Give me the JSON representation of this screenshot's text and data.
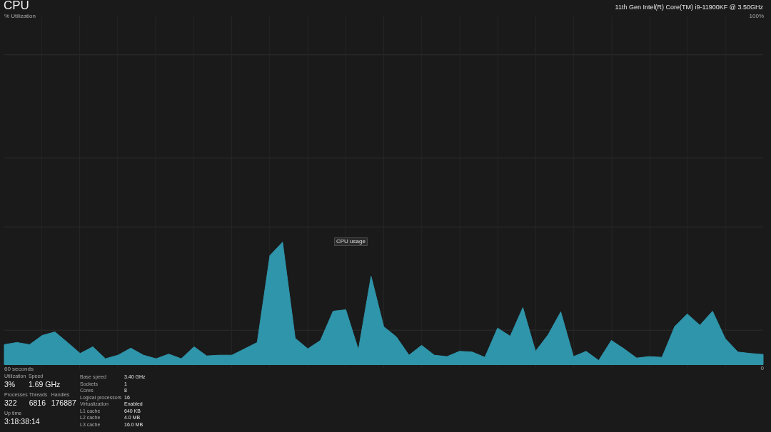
{
  "header": {
    "title": "CPU",
    "processor": "11th Gen Intel(R) Core(TM) i9-11900KF @ 3.50GHz"
  },
  "graph": {
    "chart_data": {
      "type": "area",
      "ylabel": "% Utilization",
      "xlabel": "60 seconds",
      "ylim": [
        0,
        100
      ],
      "yticks": [
        {
          "value": 100,
          "label": "100%"
        },
        {
          "value": 0,
          "label": "0"
        }
      ],
      "grid": true,
      "series": [
        {
          "color": "#2f95ab",
          "values": [
            6.8,
            7.4,
            6.8,
            9.4,
            10.4,
            7.4,
            4.3,
            6.2,
            2.8,
            3.8,
            5.8,
            3.8,
            2.8,
            4.1,
            2.8,
            6.2,
            3.6,
            3.8,
            3.8,
            5.6,
            7.4,
            32.1,
            35.9,
            8.6,
            5.6,
            8.0,
            16.3,
            16.7,
            5.3,
            26.2,
            11.9,
            9.0,
            3.8,
            6.6,
            3.8,
            3.4,
            4.9,
            4.7,
            3.2,
            11.5,
            9.2,
            17.3,
            4.9,
            9.6,
            16.1,
            3.4,
            4.9,
            2.3,
            8.0,
            5.6,
            3.0,
            3.4,
            3.2,
            11.9,
            15.5,
            12.3,
            16.3,
            8.5,
            4.7,
            4.3,
            4.0
          ]
        }
      ]
    },
    "tooltip": "CPU usage"
  },
  "stat_rows": [
    {
      "items": [
        {
          "label": "Utilization",
          "value": "3%"
        },
        {
          "label": "Speed",
          "value": "1.69 GHz"
        }
      ]
    },
    {
      "items": [
        {
          "label": "Processes",
          "value": "322"
        },
        {
          "label": "Threads",
          "value": "6816"
        },
        {
          "label": "Handles",
          "value": "176887"
        }
      ]
    },
    {
      "items": [
        {
          "label": "Up time",
          "value": "3:18:38:14"
        }
      ]
    }
  ],
  "details": [
    {
      "label": "Base speed",
      "value": "3.40 GHz"
    },
    {
      "label": "Sockets",
      "value": "1"
    },
    {
      "label": "Cores",
      "value": "8"
    },
    {
      "label": "Logical processors",
      "value": "16"
    },
    {
      "label": "Virtualization",
      "value": "Enabled"
    },
    {
      "label": "L1 cache",
      "value": "640 KB"
    },
    {
      "label": "L2 cache",
      "value": "4.0 MB"
    },
    {
      "label": "L3 cache",
      "value": "16.0 MB"
    }
  ]
}
